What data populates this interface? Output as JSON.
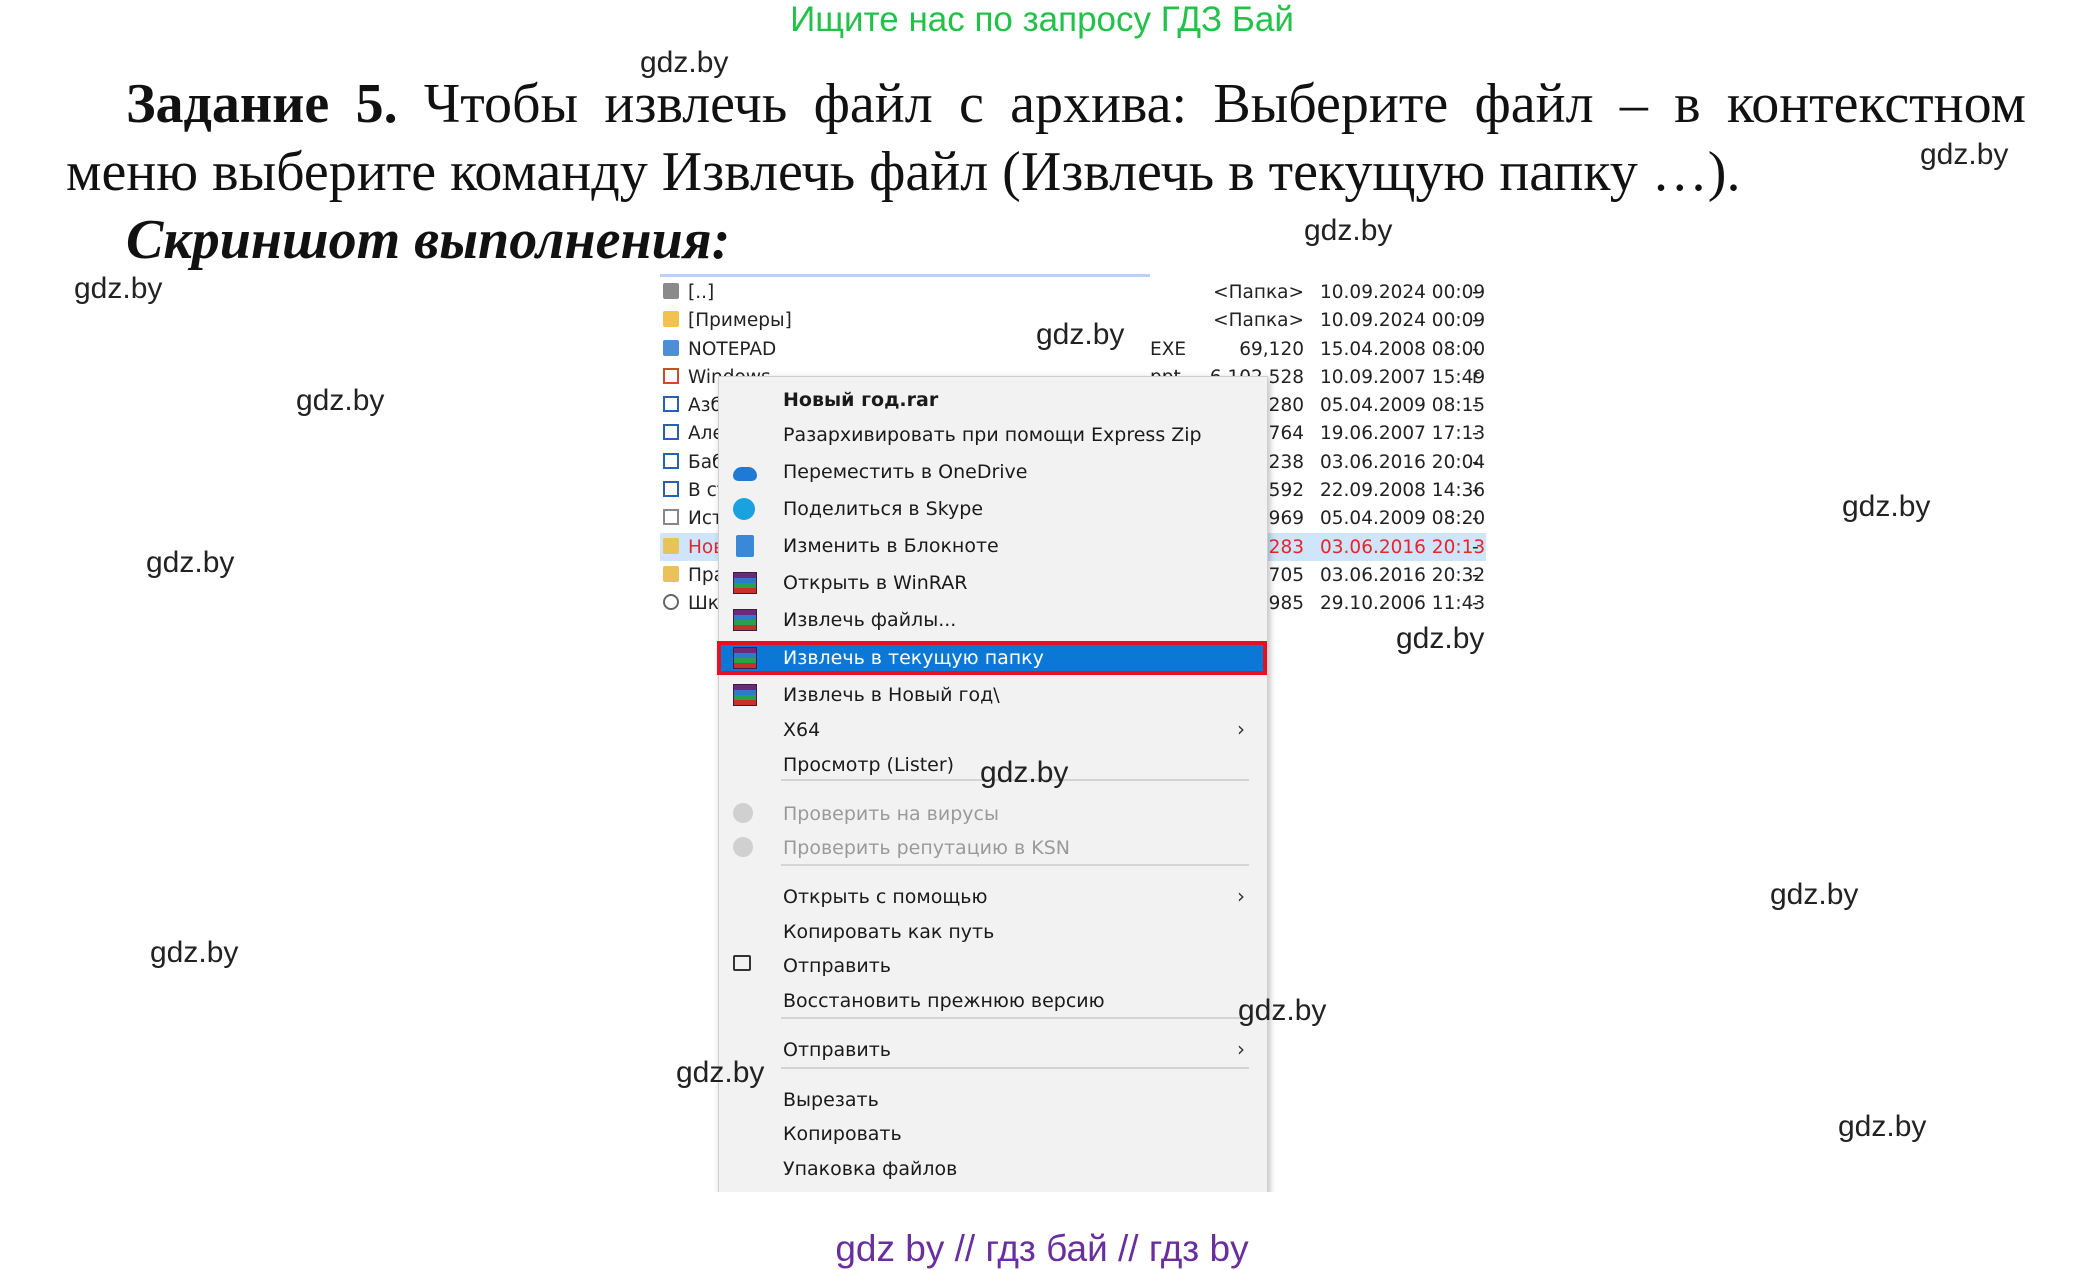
{
  "banner": "Ищите нас по запросу ГДЗ Бай",
  "task": {
    "label": "Задание 5.",
    "text": " Чтобы извлечь файл с архива: Выберите файл – в контекстном меню выберите команду Извлечь файл (Извлечь в текущую папку …).",
    "screenshot_title": "Скриншот выполнения:"
  },
  "watermark": "gdz.by",
  "files": [
    {
      "name": "[..]",
      "ext": "",
      "size": "<Папка>",
      "date": "10.09.2024 00:09",
      "attr": "-",
      "icon": "up-folder-icon"
    },
    {
      "name": "[Примеры]",
      "ext": "",
      "size": "<Папка>",
      "date": "10.09.2024 00:09",
      "attr": "-",
      "icon": "folder-icon"
    },
    {
      "name": "NOTEPAD",
      "ext": "EXE",
      "size": "69,120",
      "date": "15.04.2008 08:00",
      "attr": "-",
      "icon": "notepad-icon"
    },
    {
      "name": "Windows",
      "ext": "ppt",
      "size": "6,102,528",
      "date": "10.09.2007 15:49",
      "attr": "r",
      "icon": "ppt-icon"
    },
    {
      "name": "Азб",
      "ext": "",
      "size": "3,280",
      "date": "05.04.2009 08:15",
      "attr": "-",
      "icon": "doc-icon"
    },
    {
      "name": "Але",
      "ext": "",
      "size": "7,764",
      "date": "19.06.2007 17:13",
      "attr": "-",
      "icon": "doc-icon"
    },
    {
      "name": "Баб",
      "ext": "",
      "size": "6,238",
      "date": "03.06.2016 20:04",
      "attr": "-",
      "icon": "doc-icon"
    },
    {
      "name": "В ст",
      "ext": "",
      "size": "6,592",
      "date": "22.09.2008 14:36",
      "attr": "-",
      "icon": "doc-icon"
    },
    {
      "name": "Ист",
      "ext": "",
      "size": "0,969",
      "date": "05.04.2009 08:20",
      "attr": "-",
      "icon": "text-icon"
    },
    {
      "name": "Нов",
      "ext": "",
      "size": "6,283",
      "date": "03.06.2016 20:13",
      "attr": "-",
      "icon": "archive-icon"
    },
    {
      "name": "Пра",
      "ext": "",
      "size": "0,705",
      "date": "03.06.2016 20:32",
      "attr": "-",
      "icon": "archive-icon"
    },
    {
      "name": "Шк",
      "ext": "",
      "size": "9,985",
      "date": "29.10.2006 11:43",
      "attr": "-",
      "icon": "audio-icon"
    }
  ],
  "menu": {
    "header": "Новый год.rar",
    "items": [
      "Разархивировать при помощи Express Zip",
      "Переместить в OneDrive",
      "Поделиться в Skype",
      "Изменить в Блокноте",
      "Открыть в WinRAR",
      "Извлечь файлы...",
      "Извлечь в текущую папку",
      "Извлечь в Новый год\\",
      "X64",
      "Просмотр (Lister)",
      "Проверить на вирусы",
      "Проверить репутацию в KSN",
      "Открыть с помощью",
      "Копировать как путь",
      "Отправить",
      "Восстановить прежнюю версию",
      "Отправить",
      "Вырезать",
      "Копировать",
      "Упаковка файлов"
    ],
    "arrow": "›"
  },
  "footer": "gdz by  //  гдз бай  //  гдз by",
  "colors": {
    "banner": "#22c24a",
    "highlight": "#0a78d4",
    "highlight_border": "#e3121e",
    "footer": "#6a2f9e"
  }
}
